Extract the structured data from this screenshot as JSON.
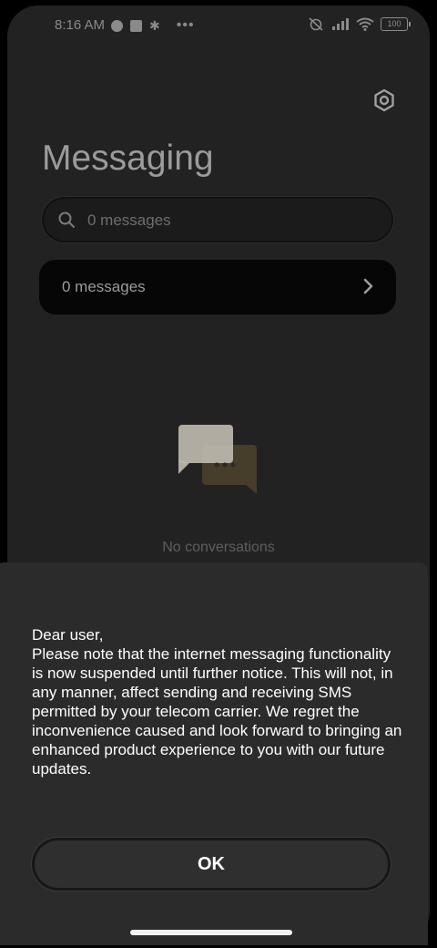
{
  "status_bar": {
    "time": "8:16 AM",
    "battery": "100"
  },
  "header": {
    "title": "Messaging",
    "settings_icon": "settings-icon"
  },
  "search": {
    "placeholder": "0 messages"
  },
  "messages_card": {
    "label": "0 messages"
  },
  "empty_state": {
    "text": "No conversations",
    "illustration": "chat-bubbles-icon"
  },
  "dialog": {
    "greeting": "Dear user,",
    "body": "Please note that the internet messaging functionality is now suspended until further notice. This will not, in any manner, affect sending and receiving SMS permitted by your telecom carrier. We regret the inconvenience caused and look forward to bringing an enhanced product experience to you with our future updates.",
    "ok_label": "OK"
  },
  "colors": {
    "background": "#222222",
    "dialog": "#2b2b2b",
    "card": "#060606",
    "bubble_light": "#bdb8ae",
    "bubble_dark": "#463d2a"
  }
}
